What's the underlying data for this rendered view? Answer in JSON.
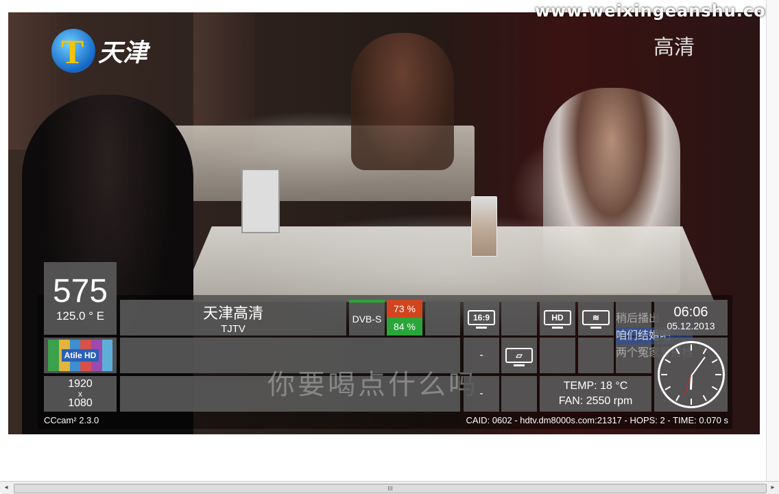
{
  "watermark": "www.weixingeanshu.com",
  "channel_logo": {
    "text": "天津"
  },
  "hd_corner_label": "高清",
  "subtitle": "你要喝点什么吗",
  "osd": {
    "channel_number": "575",
    "orbital_position": "125.0 ° E",
    "provider_logo": "Atile HD",
    "resolution": {
      "width": "1920",
      "x": "x",
      "height": "1080"
    },
    "channel_name": "天津高清",
    "channel_short": "TJTV",
    "tuner_type": "DVB-S",
    "signal_strength": "73 %",
    "signal_quality": "84 %",
    "aspect_badge": "16:9",
    "hd_badge": "HD",
    "dash1": "-",
    "dash2": "-",
    "temp": "TEMP: 18 °C",
    "fan": "FAN: 2550 rpm",
    "time": "06:06",
    "date": "05.12.2013",
    "overlay_text1": "稍后播出",
    "overlay_text2": "咱们结婚吧",
    "overlay_text3": "两个冤家爱搭档",
    "softcam": "CCcam² 2.3.0",
    "ecm_info": "CAID: 0602 - hdtv.dm8000s.com:21317 - HOPS: 2 - TIME: 0.070 s"
  },
  "colors": {
    "strength": "#d0451f",
    "quality": "#2aa53a",
    "tuner_green": "#2aa53a"
  },
  "icons": [
    "aspect-tv-icon",
    "hd-tv-icon",
    "wifi-tv-icon",
    "teletext-tv-icon"
  ],
  "scrollbar": {
    "grip": "III"
  }
}
